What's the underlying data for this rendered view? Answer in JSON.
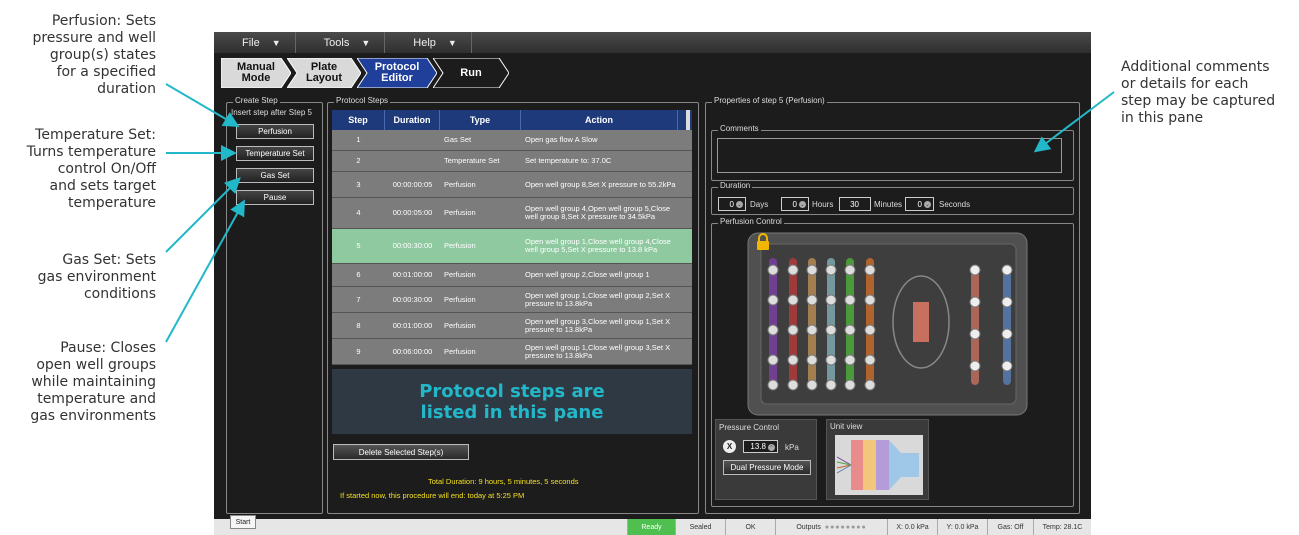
{
  "callouts": {
    "perfusion": [
      "Perfusion: Sets",
      "pressure and well",
      "group(s) states",
      "for a specified",
      "duration"
    ],
    "temperature": [
      "Temperature Set:",
      "Turns temperature",
      "control On/Off",
      "and sets target",
      "temperature"
    ],
    "gas": [
      "Gas Set: Sets",
      "gas environment",
      "conditions"
    ],
    "pause": [
      "Pause: Closes",
      "open well groups",
      "while maintaining",
      "temperature and",
      "gas environments"
    ],
    "comments": [
      "Additional comments",
      "or details for each",
      "step may be captured",
      "in this pane"
    ]
  },
  "menu": [
    "File",
    "Tools",
    "Help"
  ],
  "breadcrumbs": [
    {
      "label": "Manual\nMode",
      "color": "#d9d9d9"
    },
    {
      "label": "Plate\nLayout",
      "color": "#d9d9d9"
    },
    {
      "label": "Protocol\nEditor",
      "color": "#1f3f9a"
    },
    {
      "label": "Run",
      "color": "#1c1c1c"
    }
  ],
  "create_step": {
    "title": "Create Step",
    "subtitle": "Insert step after Step 5",
    "buttons": [
      "Perfusion",
      "Temperature Set",
      "Gas Set",
      "Pause"
    ]
  },
  "protocol_steps": {
    "title": "Protocol Steps",
    "columns": [
      "Step",
      "Duration",
      "Type",
      "Action"
    ],
    "rows": [
      {
        "step": "1",
        "duration": "",
        "type": "Gas Set",
        "action": "Open gas flow A Slow"
      },
      {
        "step": "2",
        "duration": "",
        "type": "Temperature Set",
        "action": "Set temperature to: 37.0C"
      },
      {
        "step": "3",
        "duration": "00:00:00:05",
        "type": "Perfusion",
        "action": "Open well group 8,Set X pressure to 55.2kPa"
      },
      {
        "step": "4",
        "duration": "00:00:05:00",
        "type": "Perfusion",
        "action": "Open well group 4,Open well group 5,Close well group 8,Set X pressure to 34.5kPa"
      },
      {
        "step": "5",
        "duration": "00:00:30:00",
        "type": "Perfusion",
        "action": "Open well group 1,Close well group 4,Close well group 5,Set X pressure to 13.8 kPa",
        "selected": true
      },
      {
        "step": "6",
        "duration": "00:01:00:00",
        "type": "Perfusion",
        "action": "Open well group 2,Close well group 1"
      },
      {
        "step": "7",
        "duration": "00:00:30:00",
        "type": "Perfusion",
        "action": "Open well group 1,Close well group 2,Set X pressure to 13.8kPa"
      },
      {
        "step": "8",
        "duration": "00:01:00:00",
        "type": "Perfusion",
        "action": "Open well group 3,Close well group 1,Set X pressure to 13.8kPa"
      },
      {
        "step": "9",
        "duration": "00:06:00:00",
        "type": "Perfusion",
        "action": "Open well group 1,Close well group 3,Set X pressure to 13.8kPa"
      }
    ],
    "overlay": "Protocol steps are listed in this pane",
    "delete_button": "Delete Selected Step(s)",
    "total_duration": "Total Duration: 9 hours, 5 minutes, 5 seconds",
    "end_time": "If started now, this procedure will end: today at 5:25 PM"
  },
  "properties": {
    "title": "Properties of step 5 (Perfusion)",
    "comments_label": "Comments",
    "duration_label": "Duration",
    "duration": {
      "days": "0",
      "hours": "0",
      "minutes": "30",
      "seconds": "0"
    },
    "duration_units": [
      "Days",
      "Hours",
      "Minutes",
      "Seconds"
    ],
    "perfusion_label": "Perfusion Control",
    "pressure_control": {
      "title": "Pressure Control",
      "channel": "X",
      "value": "13.8",
      "unit": "kPa",
      "mode_button": "Dual Pressure Mode"
    },
    "unit_view_title": "Unit view"
  },
  "status": {
    "start": "Start",
    "ready": "Ready",
    "sealed": "Sealed",
    "ok": "OK",
    "outputs": "Outputs",
    "x": "X: 0.0 kPa",
    "y": "Y: 0.0 kPa",
    "gas": "Gas: Off",
    "temp": "Temp: 28.1C"
  },
  "channel_colors": [
    "#7a3fa0",
    "#b03a3a",
    "#b58a52",
    "#7fa8b0",
    "#4caa3c",
    "#c46a2a",
    "#c87060",
    "#5a7fb8"
  ],
  "accent": "#23b8c9"
}
